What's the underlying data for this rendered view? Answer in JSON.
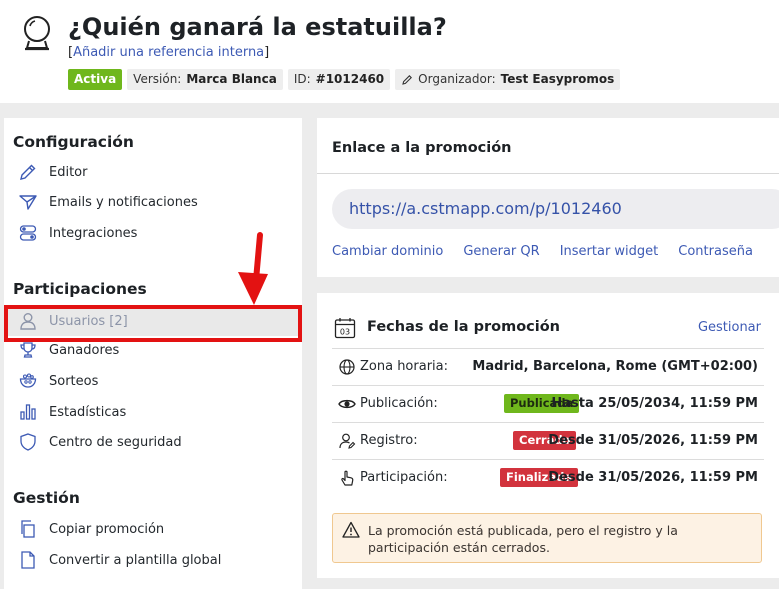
{
  "header": {
    "title": "¿Quién ganará la estatuilla?",
    "ref_open": "[",
    "ref_link": "Añadir una referencia interna",
    "ref_close": "]",
    "badges": {
      "status": "Activa",
      "version_label": "Versión:",
      "version_value": "Marca Blanca",
      "id_label": "ID:",
      "id_value": "#1012460",
      "organizer_label": "Organizador:",
      "organizer_value": "Test Easypromos"
    }
  },
  "sidebar": {
    "config_title": "Configuración",
    "config_items": [
      "Editor",
      "Emails y notificaciones",
      "Integraciones"
    ],
    "participations_title": "Participaciones",
    "participations_items": [
      "Usuarios [2]",
      "Ganadores",
      "Sorteos",
      "Estadísticas",
      "Centro de seguridad"
    ],
    "management_title": "Gestión",
    "management_items": [
      "Copiar promoción",
      "Convertir a plantilla global"
    ]
  },
  "link_panel": {
    "title": "Enlace a la promoción",
    "url": "https://a.cstmapp.com/p/1012460",
    "actions": [
      "Cambiar dominio",
      "Generar QR",
      "Insertar widget",
      "Contraseña"
    ]
  },
  "dates_panel": {
    "title": "Fechas de la promoción",
    "calendar_day": "03",
    "manage": "Gestionar",
    "rows": [
      {
        "label": "Zona horaria:",
        "status": "",
        "value": "Madrid, Barcelona, Rome (GMT+02:00)"
      },
      {
        "label": "Publicación:",
        "status": "Publicada",
        "value": "Hasta 25/05/2034, 11:59 PM"
      },
      {
        "label": "Registro:",
        "status": "Cerrado",
        "value": "Desde 31/05/2026, 11:59 PM"
      },
      {
        "label": "Participación:",
        "status": "Finalizada",
        "value": "Desde 31/05/2026, 11:59 PM"
      }
    ],
    "warning": "La promoción está publicada, pero el registro y la participación están cerrados."
  },
  "colors": {
    "accent": "#3d5ab4",
    "active_green": "#6fb71c",
    "closed_red": "#d2333d",
    "highlight_red": "#e31212"
  }
}
